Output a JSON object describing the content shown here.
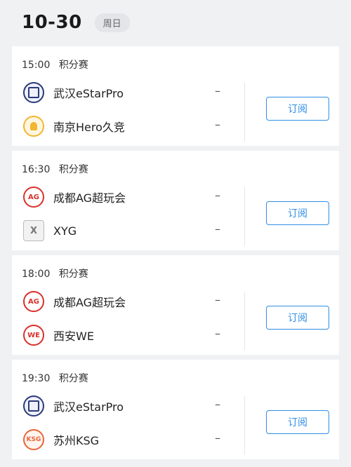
{
  "header": {
    "date": "10-30",
    "weekday": "周日"
  },
  "matches": [
    {
      "time": "15:00",
      "stage": "积分赛",
      "teams": [
        {
          "name": "武汉eStarPro",
          "score": "–",
          "logo": "estar-logo"
        },
        {
          "name": "南京Hero久竞",
          "score": "–",
          "logo": "hero-logo"
        }
      ],
      "subscribe_label": "订阅"
    },
    {
      "time": "16:30",
      "stage": "积分赛",
      "teams": [
        {
          "name": "成都AG超玩会",
          "score": "–",
          "logo": "ag-logo"
        },
        {
          "name": "XYG",
          "score": "–",
          "logo": "xyg-logo"
        }
      ],
      "subscribe_label": "订阅"
    },
    {
      "time": "18:00",
      "stage": "积分赛",
      "teams": [
        {
          "name": "成都AG超玩会",
          "score": "–",
          "logo": "ag-logo"
        },
        {
          "name": "西安WE",
          "score": "–",
          "logo": "we-logo"
        }
      ],
      "subscribe_label": "订阅"
    },
    {
      "time": "19:30",
      "stage": "积分赛",
      "teams": [
        {
          "name": "武汉eStarPro",
          "score": "–",
          "logo": "estar-logo"
        },
        {
          "name": "苏州KSG",
          "score": "–",
          "logo": "ksg-logo"
        }
      ],
      "subscribe_label": "订阅"
    }
  ],
  "colors": {
    "accent": "#2f8ee6",
    "background": "#f0f1f3",
    "card": "#ffffff"
  }
}
